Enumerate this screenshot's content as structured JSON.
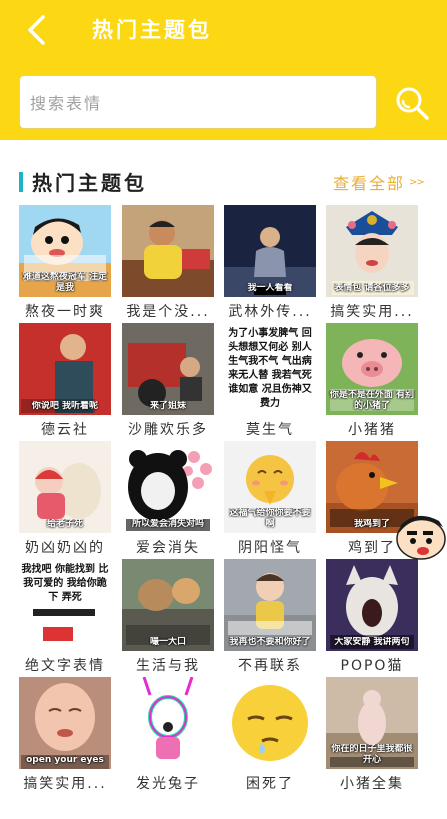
{
  "header": {
    "title": "热门主题包",
    "back_icon": "chevron-left-icon",
    "background": "#FCD814"
  },
  "search": {
    "placeholder": "搜索表情",
    "icon": "search-icon"
  },
  "section": {
    "title": "热门主题包",
    "view_all": "查看全部",
    "view_all_icon": "double-chevron-right-icon",
    "accent": "#1BB4C7",
    "link_color": "#E9AE34"
  },
  "packs": [
    {
      "label": "熬夜一时爽",
      "caption": "难道这熬夜冠军 注定是我"
    },
    {
      "label": "我是个没...",
      "caption": ""
    },
    {
      "label": "武林外传...",
      "caption": "我一人看看"
    },
    {
      "label": "搞笑实用...",
      "caption": "表情包 请各位多多"
    },
    {
      "label": "德云社",
      "caption": "你说吧 我听着呢"
    },
    {
      "label": "沙雕欢乐多",
      "caption": "来了姐妹"
    },
    {
      "label": "莫生气",
      "caption": "为了小事发脾气 回头想想又何必 别人生气我不气 气出病来无人替 我若气死谁如意 况且伤神又费力"
    },
    {
      "label": "小猪猪",
      "caption": "你是不是在外面 有别的小猪了"
    },
    {
      "label": "奶凶奶凶的",
      "caption": "给老子死"
    },
    {
      "label": "爱会消失",
      "caption": "所以爱会消失对吗"
    },
    {
      "label": "阴阳怪气",
      "caption": "这福气给你你要不要啊"
    },
    {
      "label": "鸡到了",
      "caption": "我鸡到了"
    },
    {
      "label": "绝文字表情",
      "caption": "我找吧 你能找到 比我可爱的 我给你跪下 弄死"
    },
    {
      "label": "生活与我",
      "caption": "嘬一大口"
    },
    {
      "label": "不再联系",
      "caption": "我再也不要和你好了"
    },
    {
      "label": "POPO猫",
      "caption": "大家安静 我讲两句"
    },
    {
      "label": "搞笑实用...",
      "caption": "open your eyes"
    },
    {
      "label": "发光兔子",
      "caption": ""
    },
    {
      "label": "困死了",
      "caption": ""
    },
    {
      "label": "小猪全集",
      "caption": "你在的日子里我都很开心"
    }
  ]
}
